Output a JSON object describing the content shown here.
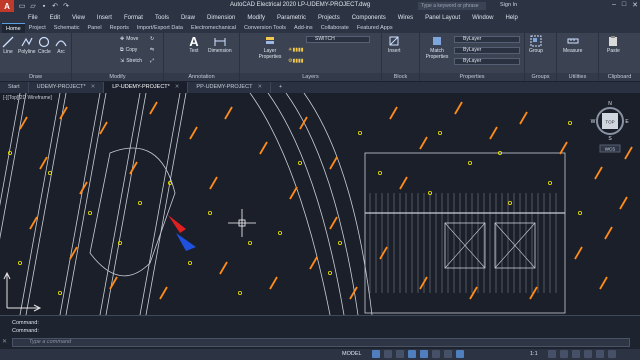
{
  "title": "AutoCAD Electrical 2020   LP-UDEMY-PROJECT.dwg",
  "search_placeholder": "Type a keyword or phrase",
  "signin": "Sign In",
  "menus": [
    "File",
    "Edit",
    "View",
    "Insert",
    "Format",
    "Tools",
    "Draw",
    "Dimension",
    "Modify",
    "Parametric",
    "Projects",
    "Components",
    "Wires",
    "Panel Layout",
    "Window",
    "Help"
  ],
  "ribbon_tabs": [
    "Home",
    "Project",
    "Schematic",
    "Panel",
    "Reports",
    "Import/Export Data",
    "Electromechanical",
    "Conversion Tools",
    "Add-ins",
    "Collaborate",
    "Featured Apps"
  ],
  "panels": {
    "draw": "Draw",
    "modify": "Modify",
    "annotation": "Annotation",
    "layers": "Layers",
    "block": "Block",
    "properties": "Properties",
    "groups": "Groups",
    "utilities": "Utilities",
    "clipboard": "Clipboard"
  },
  "draw_tools": [
    "Line",
    "Polyline",
    "Circle",
    "Arc"
  ],
  "modify_tools": [
    "Move",
    "Copy",
    "Stretch"
  ],
  "annotation_tools": [
    "Text",
    "Dimension"
  ],
  "layer_tools": {
    "properties": "Layer\nProperties",
    "current": "SWITCH"
  },
  "block_tools": [
    "Insert"
  ],
  "properties_tools": {
    "match": "Match\nProperties",
    "color": "ByLayer",
    "linetype": "ByLayer",
    "lineweight": "ByLayer"
  },
  "group_tools": [
    "Group"
  ],
  "utility_tools": [
    "Measure"
  ],
  "clipboard_tools": [
    "Paste"
  ],
  "doc_tabs": [
    "Start",
    "UDEMY-PROJECT*",
    "LP-UDEMY-PROJECT*",
    "PP-UDEMY-PROJECT"
  ],
  "active_doc_tab": 2,
  "viewport_label": "[-][Top][2D Wireframe]",
  "viewcube": {
    "face": "TOP",
    "n": "N",
    "s": "S",
    "e": "E",
    "w": "W",
    "wcs": "WCS"
  },
  "command_history": [
    "Command:",
    "Command:"
  ],
  "command_placeholder": "Type a command",
  "status": {
    "mode": "MODEL",
    "scale": "1:1"
  },
  "colors": {
    "accent": "#4f7fbf",
    "orange": "#ff8c1a",
    "yellow": "#f2e600",
    "lines": "#c9ced6"
  }
}
